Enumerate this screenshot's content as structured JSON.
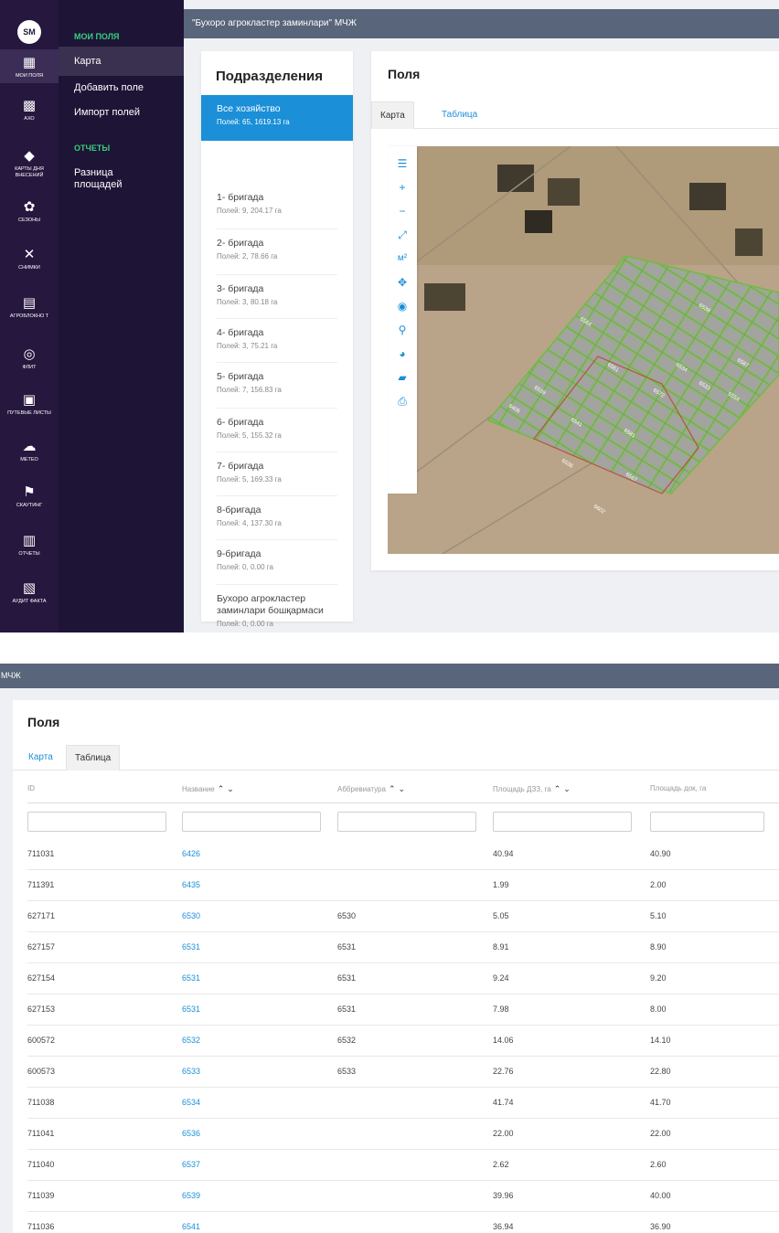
{
  "logo_text": "SM",
  "rail_items": [
    {
      "icon": "grid-icon",
      "label": "МОИ ПОЛЯ",
      "active": true
    },
    {
      "icon": "qr-icon",
      "label": "АХО"
    },
    {
      "icon": "diamond-icon",
      "label": "КАРТЫ ДНЯ ВНЕСЕНИЙ"
    },
    {
      "icon": "sprout-icon",
      "label": "СЕЗОНЫ"
    },
    {
      "icon": "satellite-icon",
      "label": "СНИМКИ"
    },
    {
      "icon": "report-icon",
      "label": "АГРОБЛОКНО Т"
    },
    {
      "icon": "target-icon",
      "label": "ФЛИТ"
    },
    {
      "icon": "printer-icon",
      "label": "ПУТЕВЫЕ ЛИСТЫ"
    },
    {
      "icon": "weather-icon",
      "label": "МЕТЕО"
    },
    {
      "icon": "scouting-icon",
      "label": "СКАУТИНГ"
    },
    {
      "icon": "document-icon",
      "label": "ОТЧЕТЫ"
    },
    {
      "icon": "audit-icon",
      "label": "АУДИТ ФАКТА"
    }
  ],
  "nav": {
    "section_fields": "МОИ ПОЛЯ",
    "item_map": "Карта",
    "item_add": "Добавить поле",
    "item_import": "Импорт полей",
    "section_reports": "ОТЧЕТЫ",
    "item_area_diff": "Разница площадей"
  },
  "header_title": "\"Бухоро агрокластер заминлари\" МЧЖ",
  "subdivisions": {
    "title": "Подразделения",
    "items": [
      {
        "name": "Все хозяйство",
        "meta": "Полей: 65, 1619.13 га",
        "active": true
      },
      {
        "name": "1- бригада",
        "meta": "Полей: 9, 204.17 га"
      },
      {
        "name": "2- бригада",
        "meta": "Полей: 2, 78.66 га"
      },
      {
        "name": "3- бригада",
        "meta": "Полей: 3, 80.18 га"
      },
      {
        "name": "4- бригада",
        "meta": "Полей: 3, 75.21 га"
      },
      {
        "name": "5- бригада",
        "meta": "Полей: 7, 156.83 га"
      },
      {
        "name": "6- бригада",
        "meta": "Полей: 5, 155.32 га"
      },
      {
        "name": "7- бригада",
        "meta": "Полей: 5, 169.33 га"
      },
      {
        "name": "8-бригада",
        "meta": "Полей: 4, 137.30 га"
      },
      {
        "name": "9-бригада",
        "meta": "Полей: 0, 0.00 га"
      },
      {
        "name": "Бухоро агрокластер заминлари бошқармаси",
        "meta": "Полей: 0, 0.00 га"
      }
    ]
  },
  "fields_panel": {
    "title": "Поля",
    "tab_map": "Карта",
    "tab_table": "Таблица"
  },
  "map_toolbar": [
    "list-icon",
    "zoom-in-icon",
    "zoom-out-icon",
    "fullscreen-icon",
    "area-icon",
    "locate-icon",
    "eye-icon",
    "search-icon",
    "globe-icon",
    "folder-icon",
    "print-icon"
  ],
  "map_area_unit": "м²",
  "map_labels": [
    "6564",
    "6538",
    "6587",
    "6561",
    "6534",
    "6533",
    "6572",
    "6554",
    "6539",
    "6406",
    "6541",
    "6581",
    "6536",
    "6567",
    "6602"
  ],
  "bottom": {
    "header_title": "МЧЖ",
    "title": "Поля",
    "tab_map": "Карта",
    "tab_table": "Таблица",
    "columns": [
      "ID",
      "Название",
      "Аббревиатура",
      "Площадь ДЗЗ, га",
      "Площадь док, га"
    ],
    "rows": [
      [
        "711031",
        "6426",
        "",
        "40.94",
        "40.90"
      ],
      [
        "711391",
        "6435",
        "",
        "1.99",
        "2.00"
      ],
      [
        "627171",
        "6530",
        "6530",
        "5.05",
        "5.10"
      ],
      [
        "627157",
        "6531",
        "6531",
        "8.91",
        "8.90"
      ],
      [
        "627154",
        "6531",
        "6531",
        "9.24",
        "9.20"
      ],
      [
        "627153",
        "6531",
        "6531",
        "7.98",
        "8.00"
      ],
      [
        "600572",
        "6532",
        "6532",
        "14.06",
        "14.10"
      ],
      [
        "600573",
        "6533",
        "6533",
        "22.76",
        "22.80"
      ],
      [
        "711038",
        "6534",
        "",
        "41.74",
        "41.70"
      ],
      [
        "711041",
        "6536",
        "",
        "22.00",
        "22.00"
      ],
      [
        "711040",
        "6537",
        "",
        "2.62",
        "2.60"
      ],
      [
        "711039",
        "6539",
        "",
        "39.96",
        "40.00"
      ],
      [
        "711036",
        "6541",
        "",
        "36.94",
        "36.90"
      ]
    ]
  }
}
